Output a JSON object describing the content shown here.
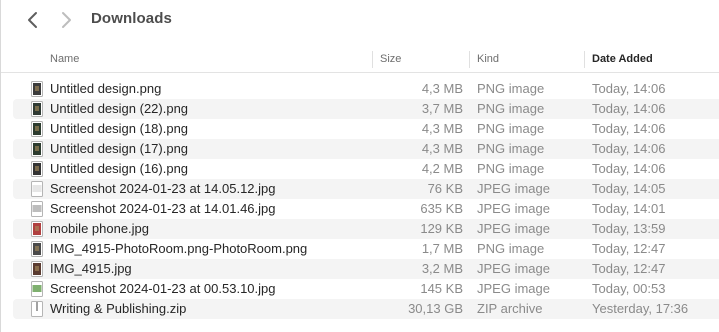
{
  "window": {
    "title": "Downloads"
  },
  "columns": {
    "name": "Name",
    "size": "Size",
    "kind": "Kind",
    "date": "Date Added"
  },
  "files": [
    {
      "name": "Untitled design.png",
      "size": "4,3 MB",
      "kind": "PNG image",
      "date": "Today, 14:06",
      "icon": "image-thumbnail-icon",
      "thumb": "#3b3b3b"
    },
    {
      "name": "Untitled design (22).png",
      "size": "3,7 MB",
      "kind": "PNG image",
      "date": "Today, 14:06",
      "icon": "image-thumbnail-icon",
      "thumb": "#2f3a33"
    },
    {
      "name": "Untitled design (18).png",
      "size": "4,3 MB",
      "kind": "PNG image",
      "date": "Today, 14:06",
      "icon": "image-thumbnail-icon",
      "thumb": "#2c3b2e"
    },
    {
      "name": "Untitled design (17).png",
      "size": "4,3 MB",
      "kind": "PNG image",
      "date": "Today, 14:06",
      "icon": "image-thumbnail-icon",
      "thumb": "#2c3b2e"
    },
    {
      "name": "Untitled design (16).png",
      "size": "4,2 MB",
      "kind": "PNG image",
      "date": "Today, 14:06",
      "icon": "image-thumbnail-icon",
      "thumb": "#333333"
    },
    {
      "name": "Screenshot 2024-01-23 at 14.05.12.jpg",
      "size": "76 KB",
      "kind": "JPEG image",
      "date": "Today, 14:05",
      "icon": "screenshot-thumbnail-icon",
      "thumb": "#e6e6e6"
    },
    {
      "name": "Screenshot 2024-01-23 at 14.01.46.jpg",
      "size": "635 KB",
      "kind": "JPEG image",
      "date": "Today, 14:01",
      "icon": "screenshot-thumbnail-icon",
      "thumb": "#bdbdbd"
    },
    {
      "name": "mobile phone.jpg",
      "size": "129 KB",
      "kind": "JPEG image",
      "date": "Today, 13:59",
      "icon": "image-thumbnail-icon",
      "thumb": "#b04040"
    },
    {
      "name": "IMG_4915-PhotoRoom.png-PhotoRoom.png",
      "size": "1,7 MB",
      "kind": "PNG image",
      "date": "Today, 12:47",
      "icon": "image-thumbnail-icon",
      "thumb": "#4a4a4a"
    },
    {
      "name": "IMG_4915.jpg",
      "size": "3,2 MB",
      "kind": "JPEG image",
      "date": "Today, 12:47",
      "icon": "image-thumbnail-icon",
      "thumb": "#5a3b30"
    },
    {
      "name": "Screenshot 2024-01-23 at 00.53.10.jpg",
      "size": "145 KB",
      "kind": "JPEG image",
      "date": "Today, 00:53",
      "icon": "screenshot-thumbnail-icon",
      "thumb": "#7fb06f"
    },
    {
      "name": "Writing & Publishing.zip",
      "size": "30,13 GB",
      "kind": "ZIP archive",
      "date": "Yesterday, 17:36",
      "icon": "zip-archive-icon",
      "thumb": "#cfcfcf"
    }
  ]
}
